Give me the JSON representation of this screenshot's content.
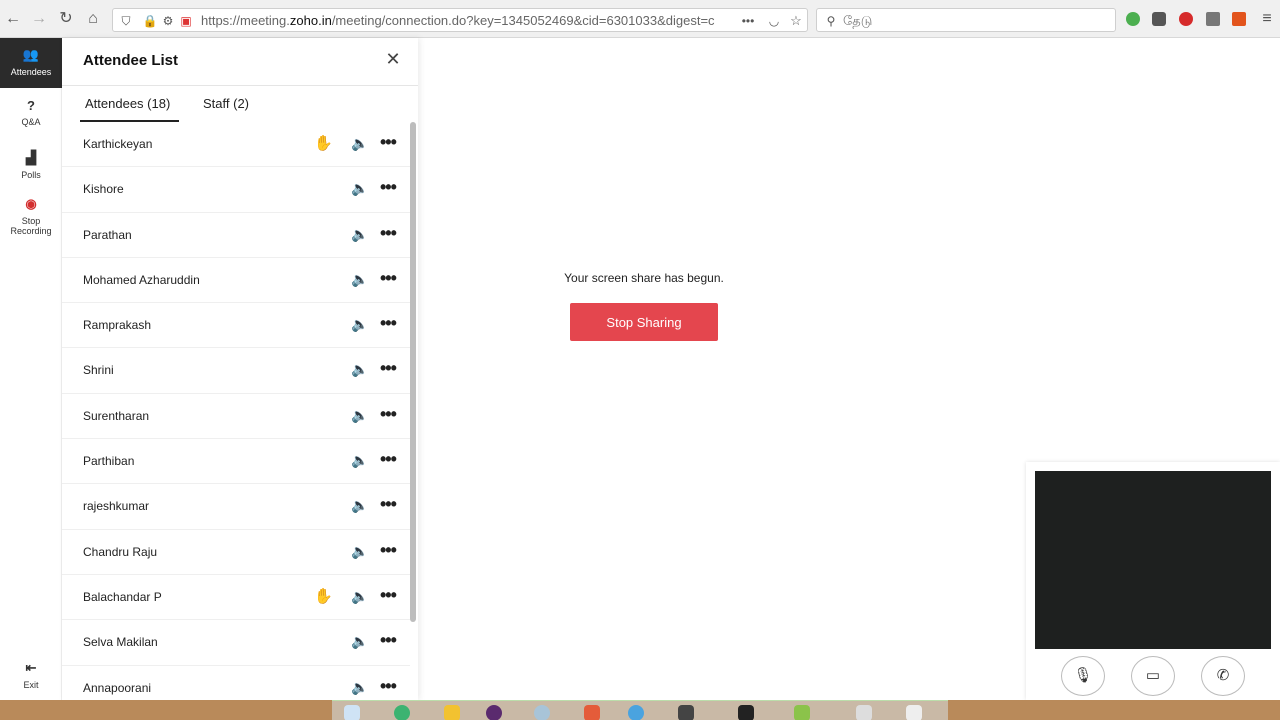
{
  "browser": {
    "url_prefix": "https://meeting.",
    "url_domain": "zoho.in",
    "url_rest": "/meeting/connection.do?key=1345052469&cid=6301033&digest=c",
    "search_placeholder": "தேடு"
  },
  "nav": {
    "attendees": "Attendees",
    "qa": "Q&A",
    "polls": "Polls",
    "stop_recording_1": "Stop",
    "stop_recording_2": "Recording",
    "exit": "Exit"
  },
  "panel": {
    "title": "Attendee List",
    "tabs": [
      "Attendees (18)",
      "Staff (2)"
    ],
    "attendees": [
      {
        "name": "Karthickeyan",
        "hand": true
      },
      {
        "name": "Kishore",
        "hand": false
      },
      {
        "name": "Parathan",
        "hand": false
      },
      {
        "name": "Mohamed Azharuddin",
        "hand": false
      },
      {
        "name": "Ramprakash",
        "hand": false
      },
      {
        "name": "Shrini",
        "hand": false
      },
      {
        "name": "Surentharan",
        "hand": false
      },
      {
        "name": "Parthiban",
        "hand": false
      },
      {
        "name": "rajeshkumar",
        "hand": false
      },
      {
        "name": "Chandru Raju",
        "hand": false
      },
      {
        "name": "Balachandar P",
        "hand": true
      },
      {
        "name": "Selva Makilan",
        "hand": false
      },
      {
        "name": "Annapoorani",
        "hand": false
      }
    ]
  },
  "share": {
    "message": "Your screen share has begun.",
    "stop_label": "Stop Sharing"
  },
  "colors": {
    "stop_button": "#e4464e",
    "raise_hand": "#f08c00"
  }
}
